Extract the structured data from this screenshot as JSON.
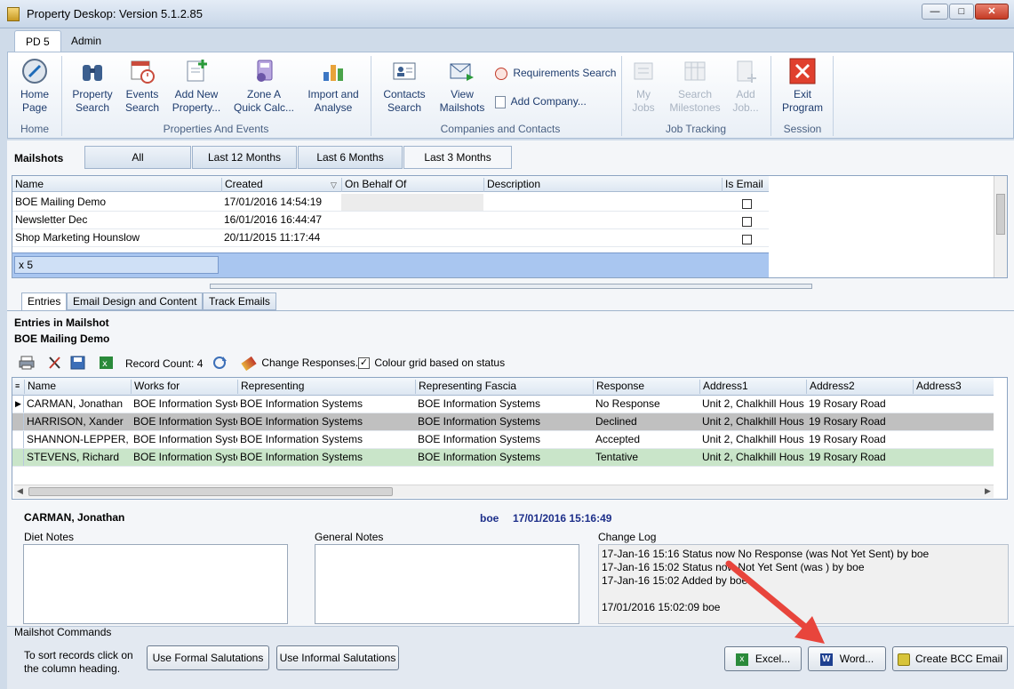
{
  "window": {
    "title": "Property Deskop: Version 5.1.2.85"
  },
  "ribbon_tabs": [
    "PD 5",
    "Admin"
  ],
  "ribbon": {
    "home": {
      "label1": "Home",
      "label2": "Page",
      "group": "Home"
    },
    "property_search": {
      "label1": "Property",
      "label2": "Search"
    },
    "events_search": {
      "label1": "Events",
      "label2": "Search"
    },
    "add_new_property": {
      "label1": "Add New",
      "label2": "Property..."
    },
    "zone_a": {
      "label1": "Zone A",
      "label2": "Quick Calc..."
    },
    "import_analyse": {
      "label1": "Import and",
      "label2": "Analyse"
    },
    "group_properties": "Properties And Events",
    "contacts_search": {
      "label1": "Contacts",
      "label2": "Search"
    },
    "view_mailshots": {
      "label1": "View",
      "label2": "Mailshots"
    },
    "requirements_search": "Requirements Search",
    "add_company": "Add Company...",
    "group_companies": "Companies and Contacts",
    "my_jobs": {
      "label1": "My",
      "label2": "Jobs"
    },
    "search_milestones": {
      "label1": "Search",
      "label2": "Milestones"
    },
    "add_job": {
      "label1": "Add",
      "label2": "Job..."
    },
    "group_jobs": "Job Tracking",
    "exit": {
      "label1": "Exit",
      "label2": "Program"
    },
    "group_session": "Session"
  },
  "mailshots": {
    "label": "Mailshots",
    "filters": [
      "All",
      "Last 12 Months",
      "Last 6 Months",
      "Last 3 Months"
    ],
    "columns": [
      "Name",
      "Created",
      "On Behalf Of",
      "Description",
      "Is Email"
    ],
    "rows": [
      {
        "name": "BOE Mailing Demo",
        "created": "17/01/2016 14:54:19"
      },
      {
        "name": "Newsletter Dec",
        "created": "16/01/2016 16:44:47"
      },
      {
        "name": "Shop Marketing Hounslow",
        "created": "20/11/2015 11:17:44"
      }
    ],
    "footer_count": "x 5"
  },
  "sub_tabs": [
    "Entries",
    "Email Design and Content",
    "Track Emails"
  ],
  "entries": {
    "heading": "Entries in Mailshot",
    "mailshot_name": "BOE Mailing Demo",
    "record_count": "Record Count: 4",
    "change_responses": "Change Responses...",
    "colour_grid": "Colour grid based on status",
    "columns": [
      "Name",
      "Works for",
      "Representing",
      "Representing Fascia",
      "Response",
      "Address1",
      "Address2",
      "Address3"
    ],
    "rows": [
      {
        "name": "CARMAN, Jonathan",
        "works_for": "BOE Information Syste",
        "representing": "BOE Information Systems",
        "fascia": "BOE Information Systems",
        "response": "No Response",
        "address1": "Unit 2, Chalkhill Hous",
        "address2": "19 Rosary Road"
      },
      {
        "name": "HARRISON, Xander",
        "works_for": "BOE Information Syste",
        "representing": "BOE Information Systems",
        "fascia": "BOE Information Systems",
        "response": "Declined",
        "address1": "Unit 2, Chalkhill Hous",
        "address2": "19 Rosary Road"
      },
      {
        "name": "SHANNON-LEPPER, C",
        "works_for": "BOE Information Syste",
        "representing": "BOE Information Systems",
        "fascia": "BOE Information Systems",
        "response": "Accepted",
        "address1": "Unit 2, Chalkhill Hous",
        "address2": "19 Rosary Road"
      },
      {
        "name": "STEVENS, Richard",
        "works_for": "BOE Information Syste",
        "representing": "BOE Information Systems",
        "fascia": "BOE Information Systems",
        "response": "Tentative",
        "address1": "Unit 2, Chalkhill Hous",
        "address2": "19 Rosary Road"
      }
    ],
    "row_colors": [
      "#ffffff",
      "#c0c0c0",
      "#ffffff",
      "#c9e5c9"
    ]
  },
  "detail": {
    "person": "CARMAN, Jonathan",
    "user": "boe",
    "timestamp": "17/01/2016 15:16:49",
    "diet_notes_label": "Diet Notes",
    "general_notes_label": "General Notes",
    "change_log_label": "Change Log",
    "change_log_lines": [
      "17-Jan-16 15:16 Status now No Response (was Not Yet Sent) by boe",
      "17-Jan-16 15:02 Status now Not Yet Sent (was ) by boe",
      "17-Jan-16 15:02 Added by boe",
      "",
      "17/01/2016 15:02:09 boe"
    ]
  },
  "commands": {
    "label": "Mailshot Commands",
    "hint1": "To sort records click on",
    "hint2": "the column heading.",
    "formal": "Use Formal Salutations",
    "informal": "Use Informal Salutations",
    "excel": "Excel...",
    "word": "Word...",
    "bcc": "Create BCC Email"
  },
  "colors": {
    "accent_arrow": "#e8453c",
    "selected_row": "#a9c6f0",
    "blue_text": "#1d2f8a"
  }
}
